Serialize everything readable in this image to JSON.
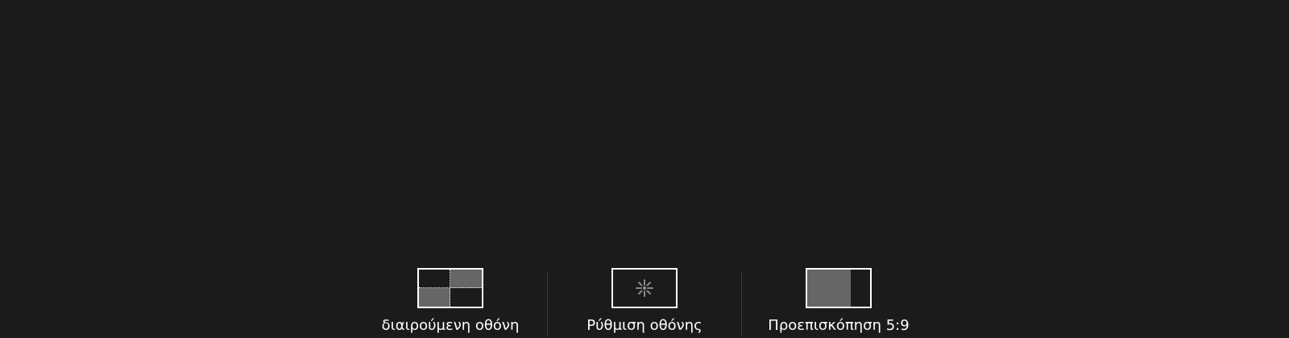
{
  "toolbar": {
    "items": [
      {
        "label": "διαιρούμενη οθόνη",
        "icon": "split-screen-icon"
      },
      {
        "label": "Ρύθμιση οθόνης",
        "icon": "screen-settings-icon"
      },
      {
        "label": "Προεπισκόπηση 5:9",
        "icon": "preview-5-9-icon"
      }
    ]
  },
  "colors": {
    "background": "#1b1b1b",
    "icon_fill": "#666666",
    "foreground": "#ffffff",
    "divider": "#3a3a3a"
  }
}
